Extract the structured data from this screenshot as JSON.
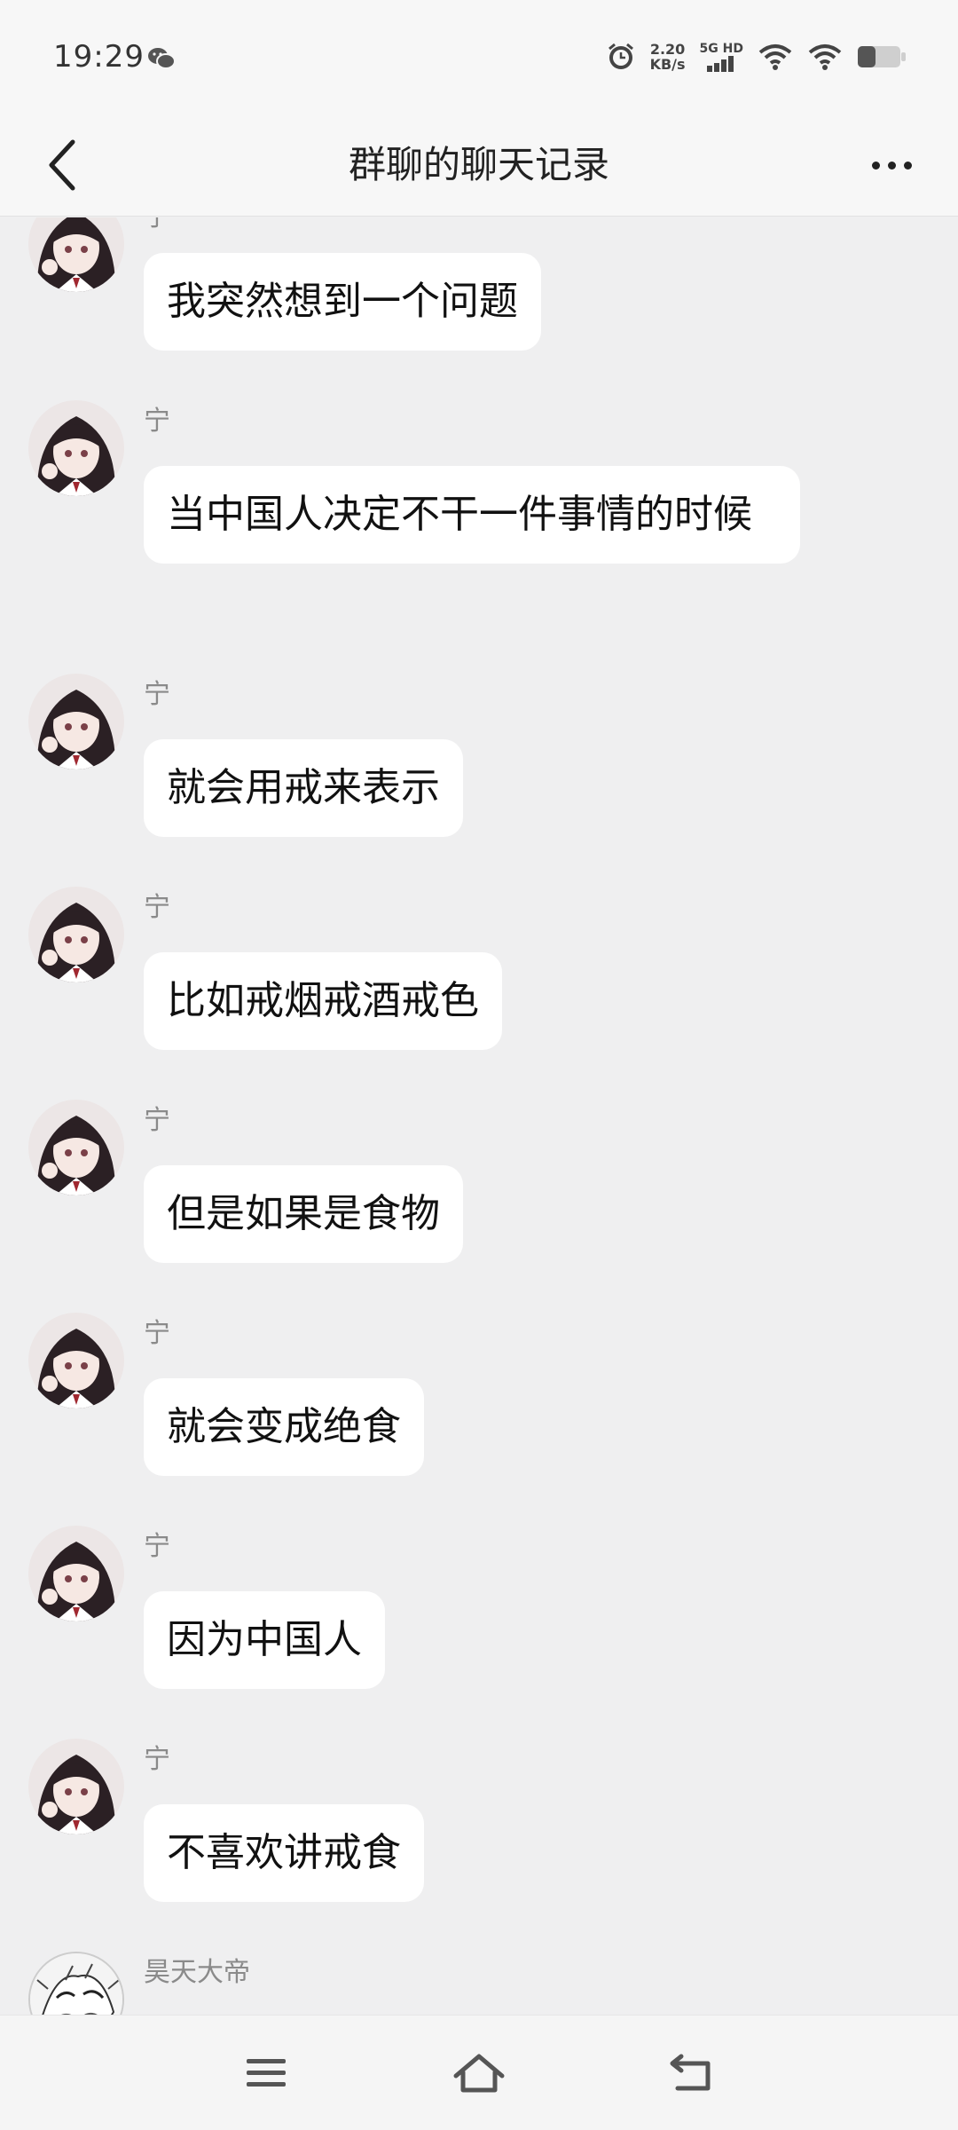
{
  "status_bar": {
    "time": "19:29",
    "net_speed_value": "2.20",
    "net_speed_unit": "KB/s",
    "net_type_1": "5G HD",
    "signal_bars": 4,
    "battery_level": 0.4
  },
  "header": {
    "title": "群聊的聊天记录"
  },
  "messages": [
    {
      "sender": "宁",
      "text": "我突然想到一个问题"
    },
    {
      "sender": "宁",
      "text": "当中国人决定不干一件事情的时候"
    },
    {
      "sender": "宁",
      "text": "就会用戒来表示"
    },
    {
      "sender": "宁",
      "text": "比如戒烟戒酒戒色"
    },
    {
      "sender": "宁",
      "text": "但是如果是食物"
    },
    {
      "sender": "宁",
      "text": "就会变成绝食"
    },
    {
      "sender": "宁",
      "text": "因为中国人"
    },
    {
      "sender": "宁",
      "text": "不喜欢讲戒食"
    },
    {
      "sender": "昊天大帝",
      "text": ""
    }
  ],
  "icons": {
    "back": "chevron-left-icon",
    "more": "more-dots-icon",
    "menu": "menu-icon",
    "home": "home-icon",
    "return": "return-icon"
  }
}
